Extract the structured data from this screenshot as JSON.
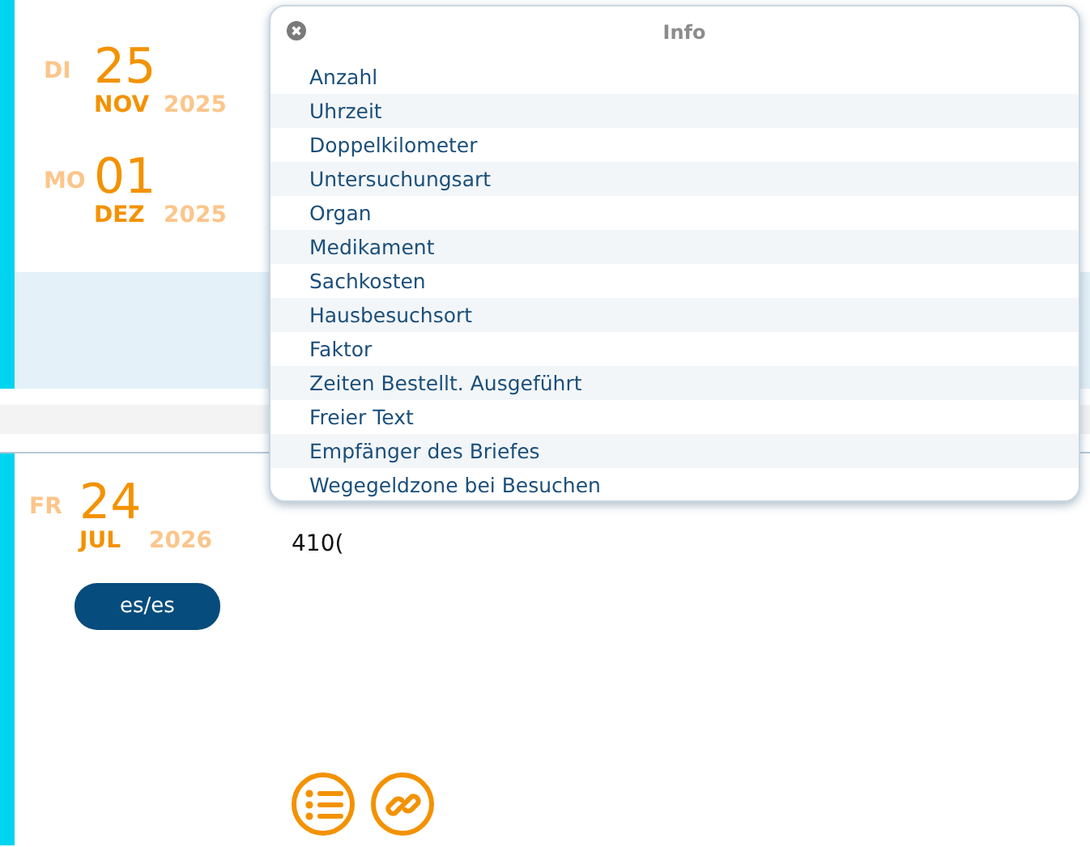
{
  "entries": [
    {
      "weekday": "DI",
      "day": "25",
      "month": "NOV",
      "year": "2025"
    },
    {
      "weekday": "MO",
      "day": "01",
      "month": "DEZ",
      "year": "2025"
    }
  ],
  "current": {
    "weekday": "FR",
    "day": "24",
    "month": "JUL",
    "year": "2026",
    "user_button": "es/es",
    "input_value": "410("
  },
  "popup": {
    "title": "Info",
    "items": [
      {
        "label": "Anzahl"
      },
      {
        "label": "Uhrzeit"
      },
      {
        "label": "Doppelkilometer"
      },
      {
        "label": "Untersuchungsart"
      },
      {
        "label": "Organ"
      },
      {
        "label": "Medikament"
      },
      {
        "label": "Sachkosten"
      },
      {
        "label": "Hausbesuchsort"
      },
      {
        "label": "Faktor"
      },
      {
        "label": "Zeiten Bestellt. Ausgeführt"
      },
      {
        "label": "Freier Text"
      },
      {
        "label": "Empfänger des Briefes"
      },
      {
        "label": "Wegegeldzone bei Besuchen"
      }
    ]
  }
}
